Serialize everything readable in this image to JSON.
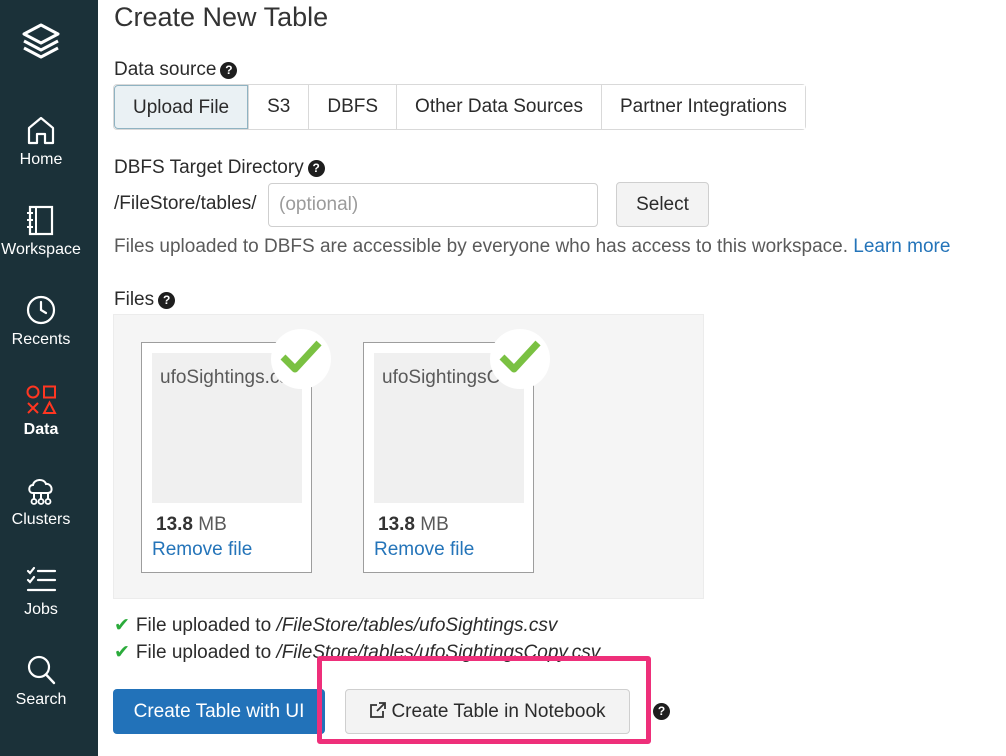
{
  "sidebar": {
    "items": [
      {
        "label": "Home",
        "icon": "home-icon"
      },
      {
        "label": "Workspace",
        "icon": "workspace-icon"
      },
      {
        "label": "Recents",
        "icon": "clock-icon"
      },
      {
        "label": "Data",
        "icon": "data-shapes-icon",
        "active": true
      },
      {
        "label": "Clusters",
        "icon": "cloud-cluster-icon"
      },
      {
        "label": "Jobs",
        "icon": "jobs-list-icon"
      },
      {
        "label": "Search",
        "icon": "search-icon"
      }
    ]
  },
  "page": {
    "title": "Create New Table"
  },
  "data_source": {
    "label": "Data source",
    "tabs": [
      "Upload File",
      "S3",
      "DBFS",
      "Other Data Sources",
      "Partner Integrations"
    ],
    "selected": "Upload File"
  },
  "target_dir": {
    "label": "DBFS Target Directory",
    "prefix": "/FileStore/tables/",
    "placeholder": "(optional)",
    "select_label": "Select",
    "info_text": "Files uploaded to DBFS are accessible by everyone who has access to this workspace.",
    "learn_more": "Learn more"
  },
  "files": {
    "label": "Files",
    "items": [
      {
        "name": "ufoSightings.cs",
        "size_value": "13.8",
        "size_unit": "MB",
        "remove_label": "Remove file"
      },
      {
        "name": "ufoSightingsCo",
        "size_value": "13.8",
        "size_unit": "MB",
        "remove_label": "Remove file"
      }
    ]
  },
  "upload_status": [
    {
      "prefix": "File uploaded to ",
      "path": "/FileStore/tables/ufoSightings.csv"
    },
    {
      "prefix": "File uploaded to ",
      "path": "/FileStore/tables/ufoSightingsCopy.csv"
    }
  ],
  "actions": {
    "create_ui": "Create Table with UI",
    "create_notebook": "Create Table in Notebook"
  },
  "colors": {
    "sidebar_bg": "#1b3139",
    "active_nav": "#ff3621",
    "primary": "#2272b9",
    "link": "#2474b9",
    "check": "#7ac142",
    "highlight": "#ee2f7a"
  }
}
